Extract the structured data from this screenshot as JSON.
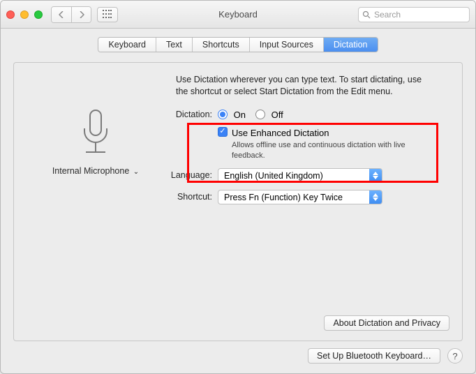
{
  "window": {
    "title": "Keyboard"
  },
  "search": {
    "placeholder": "Search"
  },
  "tabs": [
    {
      "label": "Keyboard"
    },
    {
      "label": "Text"
    },
    {
      "label": "Shortcuts"
    },
    {
      "label": "Input Sources"
    },
    {
      "label": "Dictation"
    }
  ],
  "intro": "Use Dictation wherever you can type text. To start dictating, use the shortcut or select Start Dictation from the Edit menu.",
  "mic": {
    "label": "Internal Microphone"
  },
  "dictation": {
    "label": "Dictation:",
    "on_label": "On",
    "off_label": "Off",
    "enhanced_label": "Use Enhanced Dictation",
    "enhanced_desc": "Allows offline use and continuous dictation with live feedback."
  },
  "language": {
    "label": "Language:",
    "value": "English (United Kingdom)"
  },
  "shortcut": {
    "label": "Shortcut:",
    "value": "Press Fn (Function) Key Twice"
  },
  "buttons": {
    "about": "About Dictation and Privacy",
    "bluetooth": "Set Up Bluetooth Keyboard…"
  },
  "help": "?"
}
